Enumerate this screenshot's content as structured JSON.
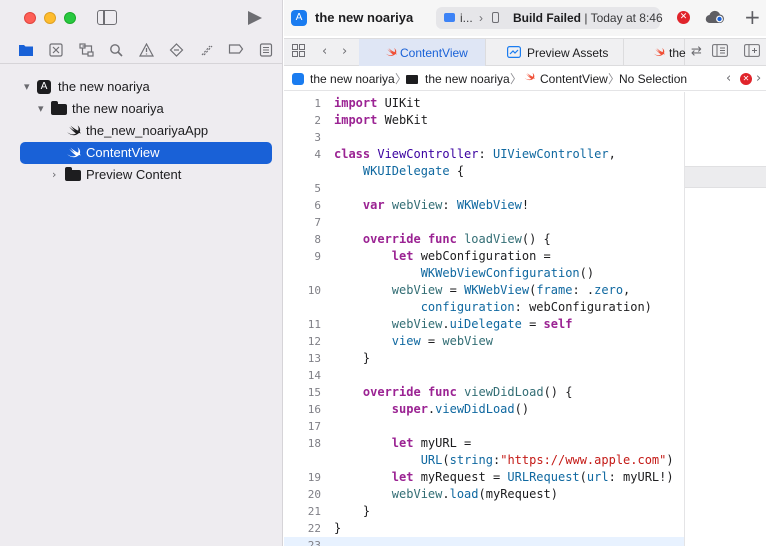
{
  "sidebar": {
    "tree": [
      {
        "label": "the new noariya",
        "icon": "xcode-project-icon",
        "disclosure": "▾"
      },
      {
        "label": "the new noariya",
        "icon": "folder-icon",
        "disclosure": "▾"
      },
      {
        "label": "the_new_noariyaApp",
        "icon": "swift-file-icon"
      },
      {
        "label": "ContentView",
        "icon": "swift-file-icon",
        "selected": true
      },
      {
        "label": "Preview Content",
        "icon": "folder-icon",
        "disclosure": "›"
      }
    ]
  },
  "toolbar": {
    "title": "the new noariya",
    "destination": "i...",
    "status_bold": "Build Failed",
    "status_rest": " | Today at 8:46"
  },
  "tabs": [
    {
      "label": "ContentView",
      "active": true
    },
    {
      "label": "Preview Assets"
    },
    {
      "label": "the"
    }
  ],
  "jumpbar": {
    "items": [
      "the new noariya",
      "the new noariya",
      "ContentView",
      "No Selection"
    ]
  },
  "code": [
    {
      "n": "1",
      "html": "<span class=\"kw\">import</span> UIKit"
    },
    {
      "n": "2",
      "html": "<span class=\"kw\">import</span> WebKit"
    },
    {
      "n": "3",
      "html": ""
    },
    {
      "n": "4",
      "html": "<span class=\"kw\">class</span> <span class=\"ty\">ViewController</span>: <span class=\"pr\">UIViewController</span>,"
    },
    {
      "n": "",
      "html": "    <span class=\"pr\">WKUIDelegate</span> {"
    },
    {
      "n": "5",
      "html": ""
    },
    {
      "n": "6",
      "html": "    <span class=\"kw\">var</span> <span class=\"fn\">webView</span>: <span class=\"pr\">WKWebView</span>!"
    },
    {
      "n": "7",
      "html": ""
    },
    {
      "n": "8",
      "html": "    <span class=\"kw\">override</span> <span class=\"kw\">func</span> <span class=\"fn\">loadView</span>() {"
    },
    {
      "n": "9",
      "html": "        <span class=\"kw\">let</span> webConfiguration ="
    },
    {
      "n": "",
      "html": "            <span class=\"pr\">WKWebViewConfiguration</span>()"
    },
    {
      "n": "10",
      "html": "        <span class=\"fn\">webView</span> = <span class=\"pr\">WKWebView</span>(<span class=\"pr\">frame</span>: .<span class=\"pr\">zero</span>,"
    },
    {
      "n": "",
      "html": "            <span class=\"pr\">configuration</span>: webConfiguration)"
    },
    {
      "n": "11",
      "html": "        <span class=\"fn\">webView</span>.<span class=\"pr\">uiDelegate</span> = <span class=\"kw\">self</span>"
    },
    {
      "n": "12",
      "html": "        <span class=\"pr\">view</span> = <span class=\"fn\">webView</span>"
    },
    {
      "n": "13",
      "html": "    }"
    },
    {
      "n": "14",
      "html": ""
    },
    {
      "n": "15",
      "html": "    <span class=\"kw\">override</span> <span class=\"kw\">func</span> <span class=\"fn\">viewDidLoad</span>() {"
    },
    {
      "n": "16",
      "html": "        <span class=\"kw\">super</span>.<span class=\"pr\">viewDidLoad</span>()"
    },
    {
      "n": "17",
      "html": ""
    },
    {
      "n": "18",
      "html": "        <span class=\"kw\">let</span> myURL ="
    },
    {
      "n": "",
      "html": "            <span class=\"pr\">URL</span>(<span class=\"pr\">string</span>:<span class=\"st\">\"https://www.apple.com\"</span>)"
    },
    {
      "n": "19",
      "html": "        <span class=\"kw\">let</span> myRequest = <span class=\"pr\">URLRequest</span>(<span class=\"pr\">url</span>: myURL!)"
    },
    {
      "n": "20",
      "html": "        <span class=\"fn\">webView</span>.<span class=\"pr\">load</span>(myRequest)"
    },
    {
      "n": "21",
      "html": "    }"
    },
    {
      "n": "22",
      "html": "}"
    },
    {
      "n": "23",
      "html": "",
      "current": true
    }
  ],
  "colors": {
    "accent": "#1961d7",
    "error": "#e0242b",
    "swift": "#f05138"
  }
}
